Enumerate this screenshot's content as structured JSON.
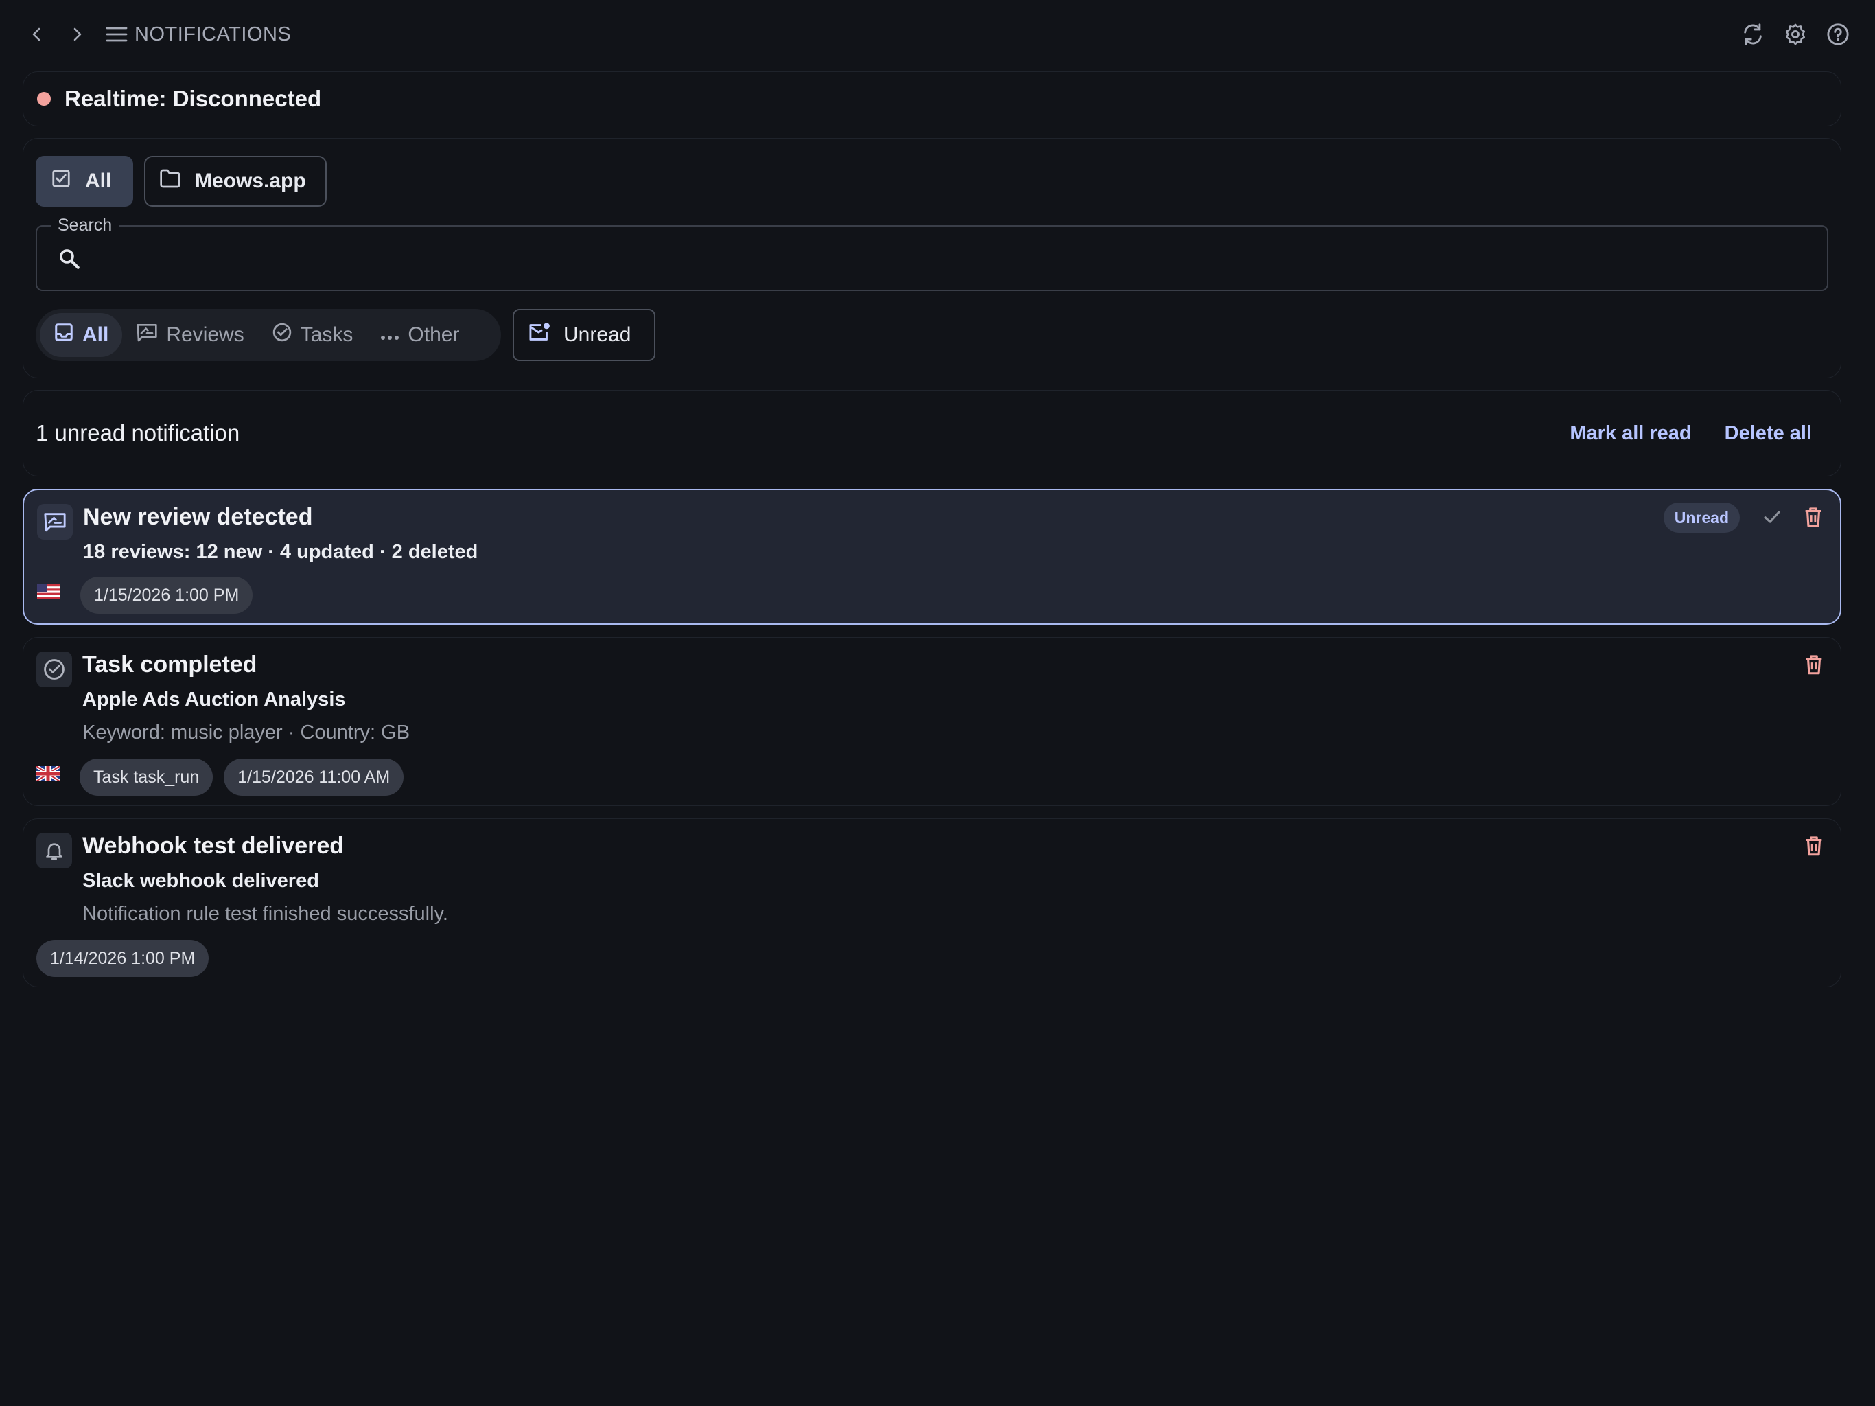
{
  "topbar": {
    "title": "NOTIFICATIONS",
    "icons": [
      "chevron-left-icon",
      "chevron-right-icon",
      "menu-icon",
      "refresh-icon",
      "gear-icon",
      "help-icon"
    ]
  },
  "realtime": {
    "status": "Realtime: Disconnected",
    "dot_color": "#f3a29d"
  },
  "scope_filters": [
    {
      "label": "All",
      "icon": "checkbox-icon",
      "active": true
    },
    {
      "label": "Meows.app",
      "icon": "folder-icon",
      "active": false
    }
  ],
  "search": {
    "label": "Search",
    "value": "",
    "placeholder": ""
  },
  "type_filters": [
    {
      "label": "All",
      "icon": "inbox-icon",
      "active": true
    },
    {
      "label": "Reviews",
      "icon": "review-icon",
      "active": false
    },
    {
      "label": "Tasks",
      "icon": "check-circle-icon",
      "active": false
    },
    {
      "label": "Other",
      "icon": "more-icon",
      "active": false
    }
  ],
  "unread_filter": {
    "label": "Unread",
    "icon": "mail-unread-icon"
  },
  "summary": {
    "text": "1 unread notification",
    "mark_all_read": "Mark all read",
    "delete_all": "Delete all"
  },
  "notifications": [
    {
      "title": "New review detected",
      "subtitle": "18 reviews: 12 new · 4 updated · 2 deleted",
      "flag": "US",
      "chips": [
        "1/15/2026 1:00 PM"
      ],
      "badge": "Unread",
      "unread": true
    },
    {
      "title": "Task completed",
      "subtitle": "Apple Ads Auction Analysis",
      "description": "Keyword: music player · Country: GB",
      "flag": "GB",
      "chips": [
        "Task task_run",
        "1/15/2026 11:00 AM"
      ],
      "unread": false
    },
    {
      "title": "Webhook test delivered",
      "subtitle": "Slack webhook delivered",
      "description": "Notification rule test finished successfully.",
      "chips": [
        "1/14/2026 1:00 PM"
      ],
      "unread": false
    }
  ],
  "colors": {
    "background": "#111318",
    "accent": "#b6c4ff",
    "unread_border": "#a9b9ef",
    "danger": "#f3a29d"
  }
}
